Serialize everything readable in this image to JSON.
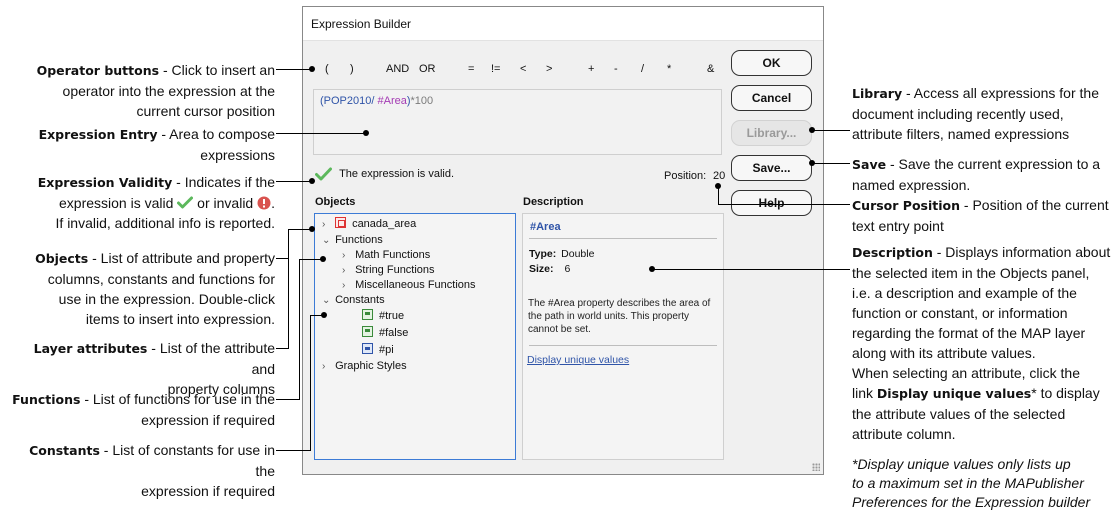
{
  "dialog": {
    "title": "Expression Builder",
    "operators": [
      "(",
      ")",
      "AND",
      "OR",
      "=",
      "!=",
      "<",
      ">",
      "+",
      "-",
      "/",
      "*",
      "&"
    ],
    "expression": {
      "t1": "(POP2010/ ",
      "t2": "#Area",
      "t3": ")",
      "t4": "*100"
    },
    "buttons": {
      "ok": "OK",
      "cancel": "Cancel",
      "library": "Library...",
      "save": "Save...",
      "help": "Help"
    },
    "validity_text": "The expression is valid.",
    "position_label": "Position:",
    "position_value": "20",
    "objects_label": "Objects",
    "description_label": "Description",
    "tree": {
      "canada_area": "canada_area",
      "functions": "Functions",
      "math_functions": "Math Functions",
      "string_functions": "String Functions",
      "misc_functions": "Miscellaneous Functions",
      "constants": "Constants",
      "true": "#true",
      "false": "#false",
      "pi": "#pi",
      "graphic_styles": "Graphic Styles"
    },
    "description": {
      "title": "#Area",
      "type_label": "Type:",
      "type_value": "Double",
      "size_label": "Size:",
      "size_value": "6",
      "text": "The #Area property describes the area of the path in world units. This property cannot be set.",
      "link": "Display unique values"
    }
  },
  "annotations": {
    "operator_buttons": {
      "title": "Operator buttons",
      "l1": " - Click to insert an",
      "l2": "operator into the expression at the",
      "l3": "current cursor position"
    },
    "expression_entry": {
      "title": "Expression Entry",
      "l1": " - Area to compose",
      "l2": "expressions"
    },
    "expression_validity": {
      "title": "Expression Validity",
      "l1": " - Indicates if the",
      "l2a": "expression is valid ",
      "l2b": " or invalid ",
      "l2c": ".",
      "l3": "If invalid, additional info is reported."
    },
    "objects": {
      "title": "Objects",
      "l1": " - List of attribute and property",
      "l2": "columns, constants and functions for",
      "l3": "use in the expression. Double-click",
      "l4": "items to insert into expression."
    },
    "layer_attributes": {
      "title": "Layer attributes",
      "l1": " - List of the attribute and",
      "l2": "property columns"
    },
    "functions": {
      "title": "Functions",
      "l1": " - List of functions for use in the",
      "l2": "expression if required"
    },
    "constants": {
      "title": "Constants",
      "l1": " - List of constants for use in the",
      "l2": "expression if required"
    },
    "library": {
      "title": "Library",
      "l1": " - Access all expressions for the",
      "l2": "document including recently used,",
      "l3": "attribute filters, named expressions"
    },
    "save": {
      "title": "Save",
      "l1": " - Save the current expression to a",
      "l2": "named expression."
    },
    "cursor_position": {
      "title": "Cursor Position",
      "l1": " - Position of the current",
      "l2": "text entry point"
    },
    "description": {
      "title": "Description",
      "l1": " - Displays information about",
      "l2": "the selected item in the Objects panel,",
      "l3": "i.e. a description and example of the",
      "l4": "function or constant, or information",
      "l5": "regarding the format of the MAP layer",
      "l6": "along with its attribute values."
    },
    "unique_values": {
      "l1": "When selecting an attribute, click the",
      "l2a": "link ",
      "l2b": "Display unique values",
      "l2c": "* to display",
      "l3": "the attribute values of the selected",
      "l4": "attribute column."
    },
    "footnote": {
      "l1": "*Display unique values only lists up",
      "l2": "to a maximum set in the MAPublisher",
      "l3": "Preferences for the Expression builder"
    }
  },
  "colors": {
    "valid_green": "#5cb85c",
    "invalid_red": "#d9534f",
    "link_blue": "#2f54a8",
    "attribute_purple": "#a43bb4"
  }
}
